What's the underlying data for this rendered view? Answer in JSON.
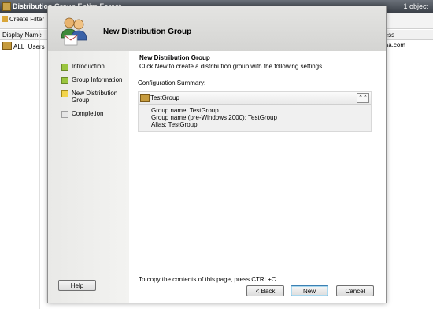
{
  "background": {
    "title": "Distribution Group Entire Forest",
    "count": "1 object",
    "create_filter": "Create Filter",
    "col_display_name": "Display Name",
    "col_address": "ress",
    "row_name": "ALL_Users",
    "row_address": "ina.com"
  },
  "dialog": {
    "title": "New Distribution Group",
    "nav": [
      {
        "label": "Introduction",
        "state": "done"
      },
      {
        "label": "Group Information",
        "state": "done"
      },
      {
        "label": "New Distribution\nGroup",
        "state": "current"
      },
      {
        "label": "Completion",
        "state": "pending"
      }
    ],
    "heading": "New Distribution Group",
    "subtitle": "Click New to create a distribution group with the following settings.",
    "config_label": "Configuration Summary:",
    "summary": {
      "name": "TestGroup",
      "lines": [
        "Group name: TestGroup",
        "Group name (pre-Windows 2000): TestGroup",
        "Alias: TestGroup"
      ]
    },
    "copy_hint": "To copy the contents of this page, press CTRL+C.",
    "buttons": {
      "help": "Help",
      "back": "< Back",
      "new": "New",
      "cancel": "Cancel"
    }
  },
  "icons": {
    "header": "users-group-icon",
    "summary_item": "group-icon",
    "collapse": "collapse-chevrons-icon"
  }
}
